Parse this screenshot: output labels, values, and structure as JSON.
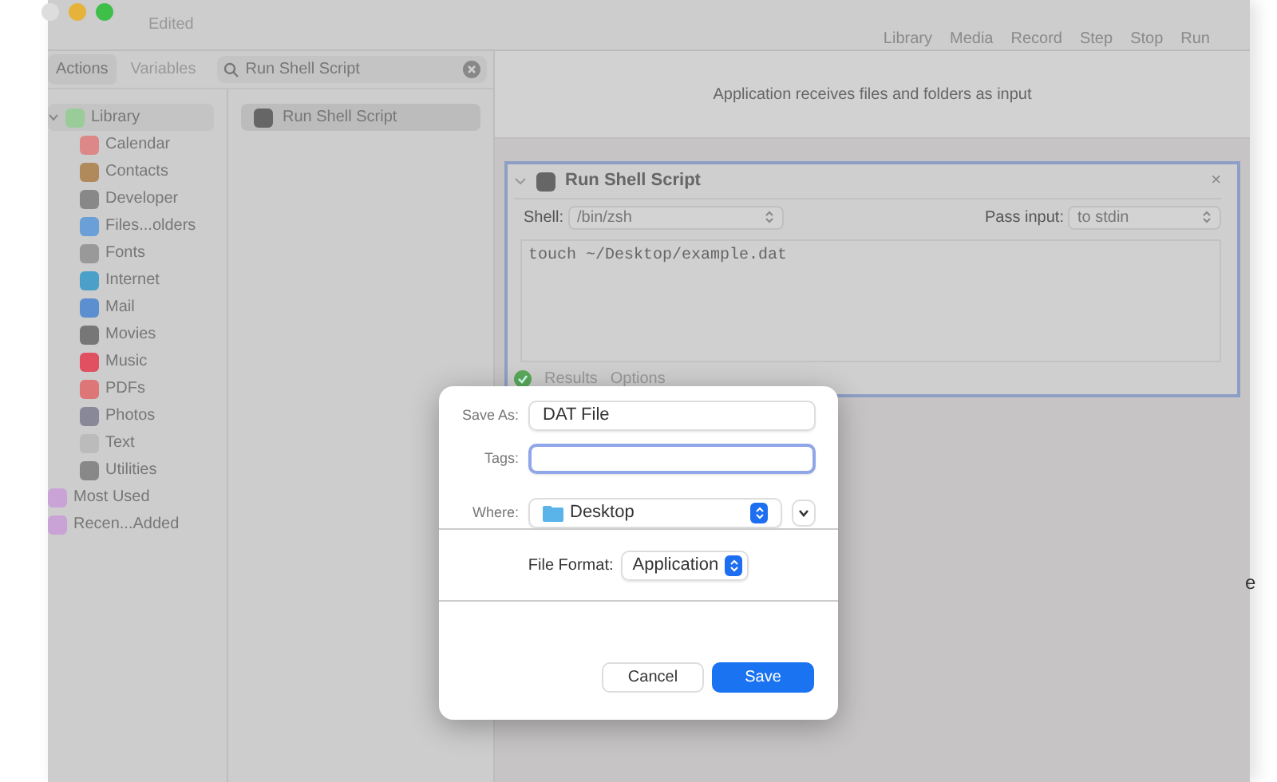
{
  "window": {
    "subtitle": "Edited",
    "toolbar": [
      "Library",
      "Media",
      "Record",
      "Step",
      "Stop",
      "Run"
    ]
  },
  "library_tabs": [
    {
      "label": "Actions",
      "selected": true
    },
    {
      "label": "Variables",
      "selected": false
    }
  ],
  "search": {
    "value": "Run Shell Script"
  },
  "sidebar": {
    "items": [
      {
        "label": "Library",
        "expanded": true,
        "selected": true,
        "children": [
          {
            "label": "Calendar"
          },
          {
            "label": "Contacts"
          },
          {
            "label": "Developer"
          },
          {
            "label": "Files...olders"
          },
          {
            "label": "Fonts"
          },
          {
            "label": "Internet"
          },
          {
            "label": "Mail"
          },
          {
            "label": "Movies"
          },
          {
            "label": "Music"
          },
          {
            "label": "PDFs"
          },
          {
            "label": "Photos"
          },
          {
            "label": "Text"
          },
          {
            "label": "Utilities"
          }
        ]
      },
      {
        "label": "Most Used",
        "selected": false
      },
      {
        "label": "Recen...Added",
        "selected": false
      }
    ]
  },
  "actions": [
    {
      "label": "Run Shell Script",
      "selected": true
    }
  ],
  "workflow_header": "Application receives files and folders as input",
  "action_card": {
    "title": "Run Shell Script",
    "close": "×",
    "shell_label": "Shell:",
    "shell": "/bin/zsh",
    "pass_label": "Pass input:",
    "pass": "to stdin",
    "script": "touch ~/Desktop/example.dat",
    "footer": [
      "Results",
      "Options"
    ]
  },
  "save_dialog": {
    "save_as_label": "Save As:",
    "save_as": "DAT File",
    "tags_label": "Tags:",
    "where_label": "Where:",
    "where": "Desktop",
    "format_label": "File Format:",
    "format": "Application",
    "buttons": [
      {
        "label": "Cancel",
        "kind": "secondary"
      },
      {
        "label": "Save",
        "kind": "primary"
      }
    ]
  },
  "edge_text": "e"
}
